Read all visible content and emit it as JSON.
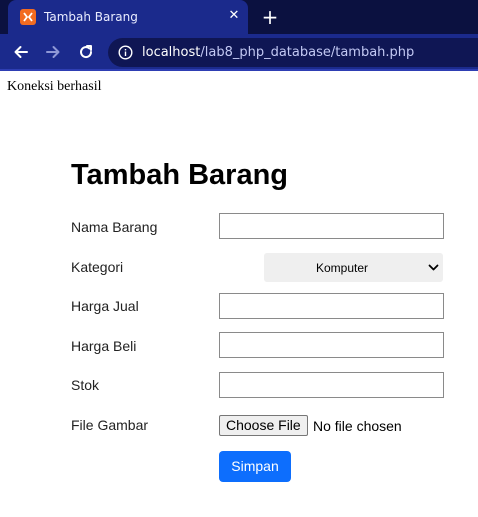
{
  "browser": {
    "tab_title": "Tambah Barang",
    "close_glyph": "✕",
    "newtab_glyph": "+",
    "url_host": "localhost",
    "url_path": "/lab8_php_database/tambah.php"
  },
  "page": {
    "connection_status": "Koneksi berhasil",
    "heading": "Tambah Barang"
  },
  "form": {
    "fields": {
      "nama_barang": {
        "label": "Nama Barang",
        "value": ""
      },
      "kategori": {
        "label": "Kategori",
        "selected": "Komputer"
      },
      "harga_jual": {
        "label": "Harga Jual",
        "value": ""
      },
      "harga_beli": {
        "label": "Harga Beli",
        "value": ""
      },
      "stok": {
        "label": "Stok",
        "value": ""
      },
      "file_gambar": {
        "label": "File Gambar",
        "button": "Choose File",
        "status": "No file chosen"
      }
    },
    "submit_label": "Simpan"
  },
  "colors": {
    "tabstrip": "#0b1140",
    "toolbar": "#1b2a8c",
    "accent": "#0d6efd",
    "favicon": "#f26b21"
  },
  "icons": [
    "xampp-icon",
    "close-icon",
    "plus-icon",
    "back-arrow-icon",
    "forward-arrow-icon",
    "reload-icon",
    "info-icon",
    "chevron-down-icon"
  ]
}
